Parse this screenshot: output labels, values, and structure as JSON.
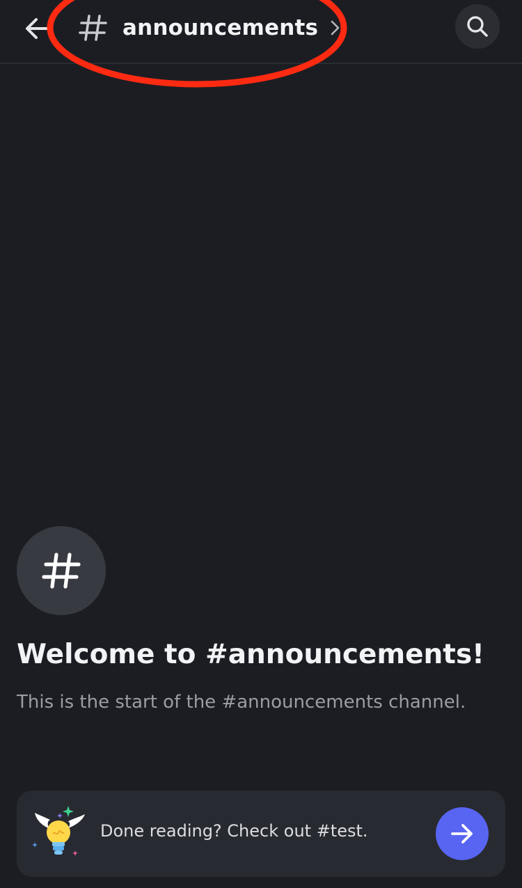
{
  "header": {
    "channel_name": "announcements",
    "back_icon": "arrow-left-icon",
    "hash_icon": "hash-icon",
    "chevron_icon": "chevron-right-icon",
    "search_icon": "search-icon",
    "annotation_color": "#ff2a12"
  },
  "welcome": {
    "title": "Welcome to #announcements!",
    "description": "This is the start of the #announcements channel.",
    "avatar_icon": "hash-icon"
  },
  "next_channel": {
    "text": "Done reading? Check out #test.",
    "illustration": "winged-lightbulb-icon",
    "button_icon": "arrow-right-icon",
    "button_color": "#5865f2"
  },
  "colors": {
    "background": "#1c1d22",
    "text_primary": "#f2f3f5",
    "text_muted": "#9b9da6",
    "card_background": "#282a31"
  }
}
